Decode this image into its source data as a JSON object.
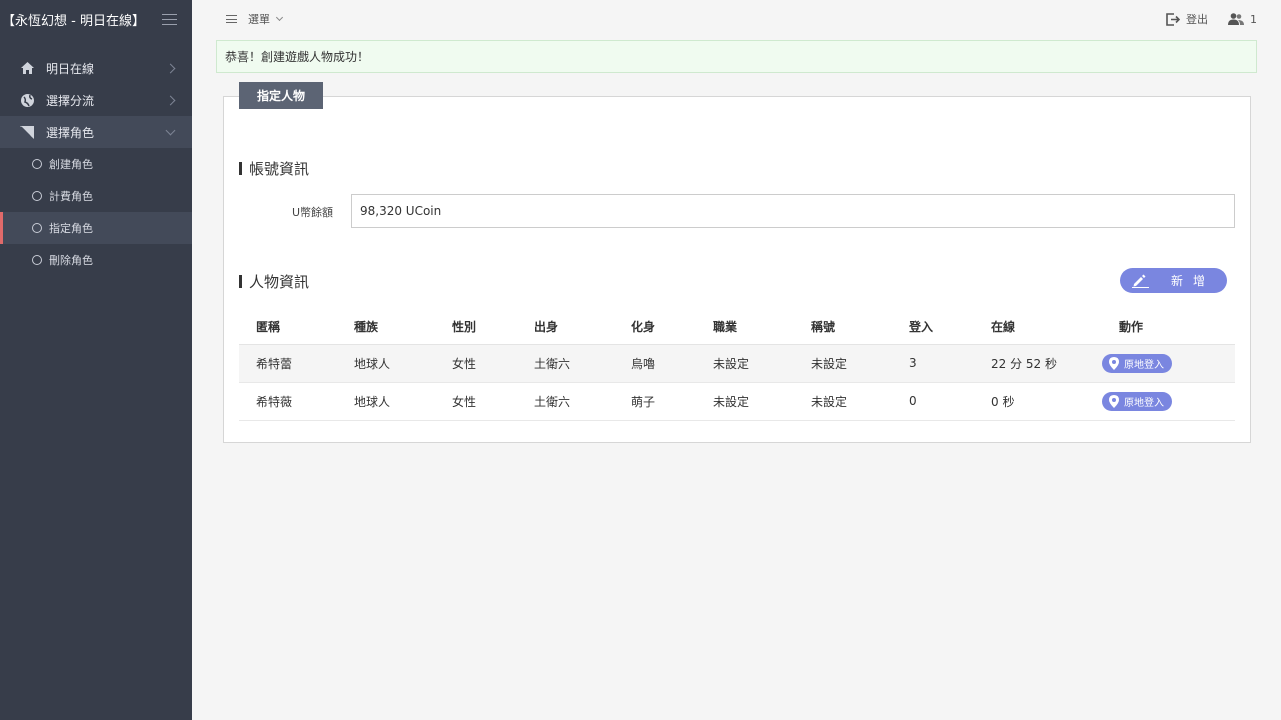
{
  "app": {
    "title": "【永恆幻想 - 明日在線】"
  },
  "sidebar": {
    "items": [
      {
        "label": "明日在線",
        "icon": "home-icon"
      },
      {
        "label": "選擇分流",
        "icon": "globe-icon"
      },
      {
        "label": "選擇角色",
        "icon": "send-icon"
      }
    ],
    "sub_items": [
      {
        "label": "創建角色"
      },
      {
        "label": "計費角色"
      },
      {
        "label": "指定角色"
      },
      {
        "label": "刪除角色"
      }
    ],
    "active_sub": "指定角色"
  },
  "topbar": {
    "menu_label": "選單",
    "logout_label": "登出",
    "online_count": "1"
  },
  "alert": {
    "message": "恭喜！創建遊戲人物成功！"
  },
  "panel": {
    "tab": "指定人物",
    "account_section": "帳號資訊",
    "ucoin_label": "U幣餘額",
    "ucoin_value": "98,320 UCoin",
    "char_section": "人物資訊",
    "add_button": "新增"
  },
  "table": {
    "headers": [
      "匿稱",
      "種族",
      "性別",
      "出身",
      "化身",
      "職業",
      "稱號",
      "登入",
      "在線",
      "動作"
    ],
    "rows": [
      {
        "name": "希特蕾",
        "race": "地球人",
        "gender": "女性",
        "origin": "土衛六",
        "avatar": "烏嚕",
        "job": "未設定",
        "title": "未設定",
        "logins": "3",
        "online": "22 分 52 秒",
        "action": "原地登入"
      },
      {
        "name": "希特薇",
        "race": "地球人",
        "gender": "女性",
        "origin": "土衛六",
        "avatar": "萌子",
        "job": "未設定",
        "title": "未設定",
        "logins": "0",
        "online": "0 秒",
        "action": "原地登入"
      }
    ]
  },
  "colors": {
    "sidebar_bg": "#373d4a",
    "accent": "#7a86e0",
    "active_marker": "#e06a6a",
    "alert_bg": "#f0fbf0"
  }
}
